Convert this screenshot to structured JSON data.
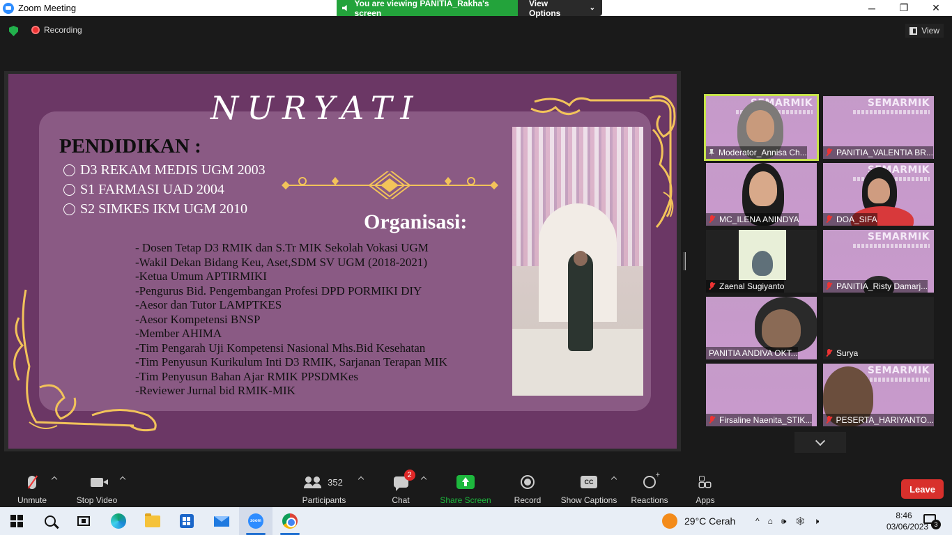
{
  "window": {
    "title": "Zoom Meeting",
    "minimize": "─",
    "restore": "❐",
    "close": "✕"
  },
  "banner": {
    "viewing_text": "You are viewing PANITIA_Rakha's screen",
    "view_options": "View Options"
  },
  "topbar": {
    "recording": "Recording",
    "view": "View"
  },
  "slide": {
    "name": "NURYATI",
    "education_title": "PENDIDIKAN :",
    "education": [
      "D3 REKAM MEDIS UGM 2003",
      "S1 FARMASI UAD 2004",
      "S2  SIMKES IKM UGM 2010"
    ],
    "organization_title": "Organisasi:",
    "organization": [
      "- Dosen Tetap D3 RMIK dan S.Tr MIK Sekolah Vokasi UGM",
      "-Wakil Dekan Bidang Keu, Aset,SDM SV UGM (2018-2021)",
      "-Ketua Umum APTIRMIKI",
      "-Pengurus Bid. Pengembangan Profesi DPD PORMIKI DIY",
      "-Aesor dan Tutor LAMPTKES",
      "-Aesor Kompetensi BNSP",
      "-Member AHIMA",
      "-Tim Pengarah Uji Kompetensi Nasional Mhs.Bid Kesehatan",
      "-Tim Penyusun Kurikulum Inti D3 RMIK, Sarjanan Terapan MIK",
      "-Tim Penyusun Bahan Ajar RMIK PPSDMKes",
      "-Reviewer Jurnal bid RMIK-MIK"
    ]
  },
  "gallery": {
    "brand": "SEMARMIK",
    "tiles": [
      {
        "label": "Moderator_Annisa Ch..."
      },
      {
        "label": "PANITIA_VALENTIA BR..."
      },
      {
        "label": "MC_ILENA ANINDYA"
      },
      {
        "label": "DOA_SIFA"
      },
      {
        "label": "Zaenal Sugiyanto"
      },
      {
        "label": "PANITIA_Risty Damarj..."
      },
      {
        "label": "PANITIA ANDIVA OKT..."
      },
      {
        "label": "Surya"
      },
      {
        "label": "Firsaline Naenita_STIK..."
      },
      {
        "label": "PESERTA_HARIYANTO..."
      }
    ]
  },
  "toolbar": {
    "unmute": "Unmute",
    "stop_video": "Stop Video",
    "participants": "Participants",
    "participants_count": "352",
    "chat": "Chat",
    "chat_badge": "2",
    "share_screen": "Share Screen",
    "record": "Record",
    "show_captions": "Show Captions",
    "captions_icon": "CC",
    "reactions": "Reactions",
    "apps": "Apps",
    "leave": "Leave"
  },
  "taskbar": {
    "zoom_icon_text": "zoom",
    "weather": "29°C  Cerah",
    "time": "8:46",
    "date": "03/06/2023",
    "notifications": "3",
    "tray": {
      "up": "^",
      "language": "⌂",
      "speaker": "🕪",
      "network": "🕸",
      "mute": "🕨"
    }
  },
  "colors": {
    "slide_bg": "#6b3765",
    "slide_panel": "#8a5a84",
    "gold": "#f2c35a",
    "active_speaker": "#c7e34b",
    "share_green": "#1db83d",
    "leave_red": "#d8302c"
  }
}
